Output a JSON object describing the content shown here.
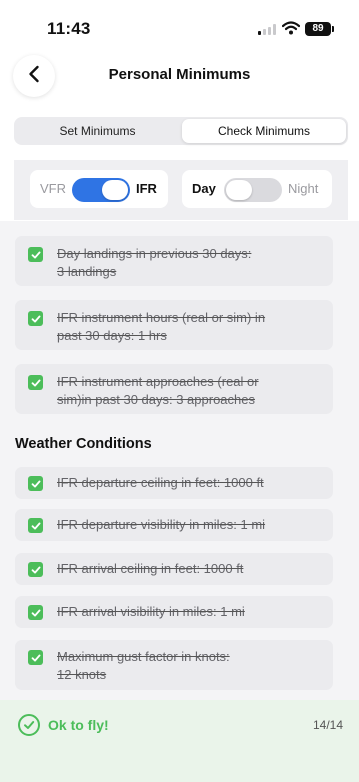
{
  "status_bar": {
    "time": "11:43",
    "battery": "89"
  },
  "nav": {
    "title": "Personal Minimums",
    "back_icon": "chevron-left-icon"
  },
  "segments": {
    "set_label": "Set Minimums",
    "check_label": "Check Minimums",
    "selected": "Check Minimums"
  },
  "toggles": {
    "flight_rules": {
      "left_label": "VFR",
      "right_label": "IFR",
      "state": "IFR"
    },
    "time_of_day": {
      "left_label": "Day",
      "right_label": "Night",
      "state": "Day"
    }
  },
  "checklist": [
    {
      "line1": "Day landings in previous 30 days:",
      "line2": "3 landings",
      "checked": true
    },
    {
      "line1": "IFR instrument hours (real or sim) in",
      "line2": "past 30 days: 1 hrs",
      "checked": true
    },
    {
      "line1": "IFR instrument approaches (real or",
      "line2": "sim)in past 30 days: 3 approaches",
      "checked": true
    }
  ],
  "weather": {
    "heading": "Weather Conditions",
    "items": [
      {
        "line1": "IFR departure ceiling in feet: 1000 ft",
        "line2": "",
        "checked": true
      },
      {
        "line1": "IFR departure visibility in miles: 1 mi",
        "line2": "",
        "checked": true
      },
      {
        "line1": "IFR arrival ceiling in feet: 1000 ft",
        "line2": "",
        "checked": true
      },
      {
        "line1": "IFR arrival visibility in miles: 1 mi",
        "line2": "",
        "checked": true
      },
      {
        "line1": "Maximum gust factor in knots:",
        "line2": "12 knots",
        "checked": true
      }
    ]
  },
  "result": {
    "message": "Ok to fly!",
    "count": "14/14",
    "color": "#4cbd5a",
    "icon": "check-circle-icon"
  },
  "colors": {
    "accent_blue": "#2f74e4",
    "check_green": "#4cbd5a"
  }
}
